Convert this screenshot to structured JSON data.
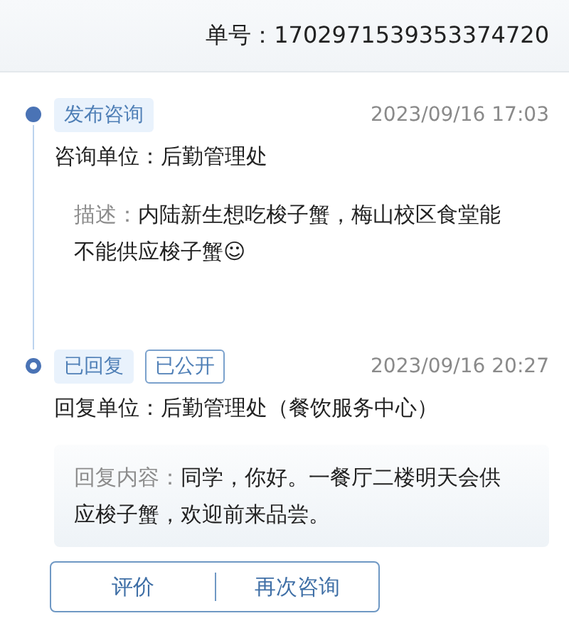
{
  "order_number": {
    "label": "单号：",
    "value": "1702971539353374720"
  },
  "timeline": [
    {
      "kind": "filled",
      "tags": [
        {
          "label": "发布咨询",
          "kind": "filled"
        }
      ],
      "time": "2023/09/16 17:03",
      "unit": "咨询单位：后勤管理处",
      "detail": {
        "label": "描述：",
        "text": "内陆新生想吃梭子蟹，梅山校区食堂能不能供应梭子蟹☺",
        "boxed": false
      }
    },
    {
      "kind": "ring",
      "tags": [
        {
          "label": "已回复",
          "kind": "filled"
        },
        {
          "label": "已公开",
          "kind": "outlined"
        }
      ],
      "time": "2023/09/16 20:27",
      "unit": "回复单位：后勤管理处（餐饮服务中心）",
      "detail": {
        "label": "回复内容：",
        "text": "同学，你好。一餐厅二楼明天会供应梭子蟹，欢迎前来品尝。",
        "boxed": true
      }
    }
  ],
  "actions": [
    "评价",
    "再次咨询"
  ]
}
